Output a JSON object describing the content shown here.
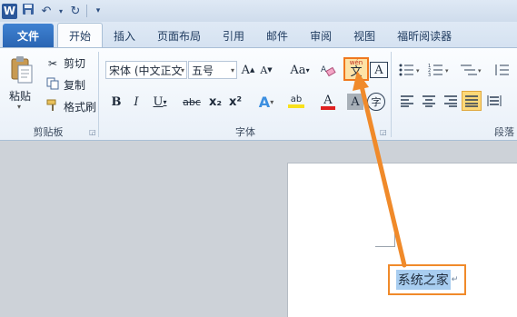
{
  "qat": {
    "app_icon": "W",
    "save_icon": "save-icon",
    "undo_icon": "undo-icon",
    "redo_icon": "redo-icon"
  },
  "tabs": [
    {
      "label": "文件"
    },
    {
      "label": "开始"
    },
    {
      "label": "插入"
    },
    {
      "label": "页面布局"
    },
    {
      "label": "引用"
    },
    {
      "label": "邮件"
    },
    {
      "label": "审阅"
    },
    {
      "label": "视图"
    },
    {
      "label": "福昕阅读器"
    }
  ],
  "clipboard": {
    "paste_label": "粘贴",
    "cut_label": "剪切",
    "copy_label": "复制",
    "format_painter_label": "格式刷",
    "group_label": "剪贴板"
  },
  "font": {
    "font_name": "宋体 (中文正文",
    "font_size": "五号",
    "group_label": "字体",
    "grow_font": "A",
    "shrink_font": "A",
    "change_case": "Aa",
    "bold": "B",
    "italic": "I",
    "underline": "U",
    "strikethrough": "abc",
    "subscript": "x₂",
    "superscript": "x²",
    "text_effects": "A",
    "highlight": "ab",
    "font_color": "A",
    "char_shading": "A",
    "enclose_char": "字",
    "phonetic_guide_top": "wén",
    "phonetic_guide_char": "文",
    "char_border": "A"
  },
  "paragraph": {
    "group_label": "段落"
  },
  "document": {
    "selected_text": "系统之家",
    "return_mark": "↵"
  },
  "colors": {
    "accent": "#2b579a",
    "callout_border": "#f08a2a",
    "highlight_yellow": "#fcd878",
    "selection": "#a8cdf0",
    "font_color_red": "#e02020"
  }
}
